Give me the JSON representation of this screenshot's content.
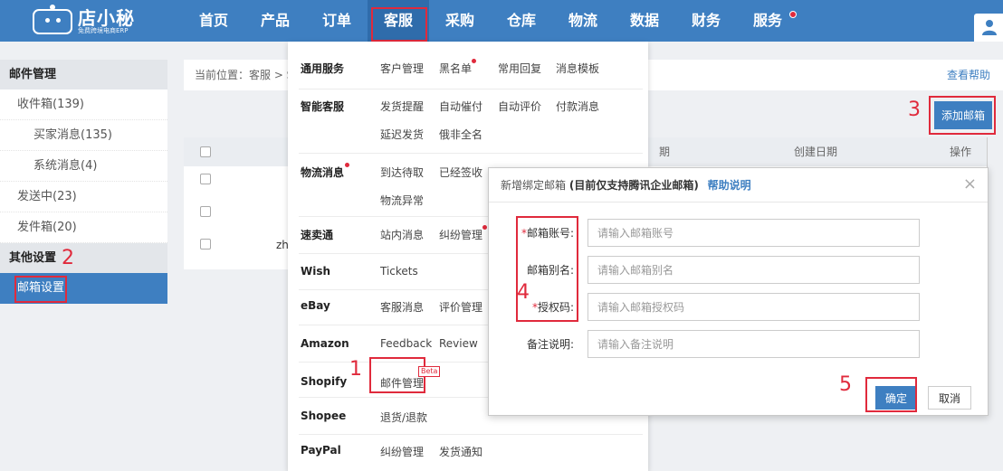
{
  "logo": {
    "main": "店小秘",
    "sub": "免费跨境电商ERP"
  },
  "nav": {
    "items": [
      "首页",
      "产品",
      "订单",
      "客服",
      "采购",
      "仓库",
      "物流",
      "数据",
      "财务",
      "服务"
    ],
    "active_index": 3
  },
  "sidebar": {
    "mail_header": "邮件管理",
    "inbox": "收件箱(139)",
    "buyer_msg": "买家消息(135)",
    "system_msg": "系统消息(4)",
    "sending": "发送中(23)",
    "outbox": "发件箱(20)",
    "other_header": "其他设置",
    "mailbox_settings": "邮箱设置"
  },
  "breadcrumb": {
    "text": "当前位置：客服 > S",
    "help": "查看帮助"
  },
  "toolbar": {
    "add_mailbox": "添加邮箱"
  },
  "table": {
    "col_period": "期",
    "col_created": "创建日期",
    "col_actions": "操作",
    "row3_text": "zh"
  },
  "dropdown": {
    "groups": [
      {
        "label": "通用服务",
        "links": [
          "客户管理",
          "黑名单",
          "常用回复",
          "消息模板"
        ]
      },
      {
        "label": "智能客服",
        "links": [
          "发货提醒",
          "自动催付",
          "自动评价",
          "付款消息",
          "延迟发货",
          "俄非全名"
        ]
      },
      {
        "label": "物流消息",
        "links": [
          "到达待取",
          "已经签收",
          "物流异常"
        ]
      },
      {
        "label": "速卖通",
        "links": [
          "站内消息",
          "纠纷管理"
        ]
      },
      {
        "label": "Wish",
        "links": [
          "Tickets"
        ]
      },
      {
        "label": "eBay",
        "links": [
          "客服消息",
          "评价管理"
        ]
      },
      {
        "label": "Amazon",
        "links": [
          "Feedback",
          "Review"
        ]
      },
      {
        "label": "Shopify",
        "links": [
          "邮件管理"
        ]
      },
      {
        "label": "Shopee",
        "links": [
          "退货/退款"
        ]
      },
      {
        "label": "PayPal",
        "links": [
          "纠纷管理",
          "发货通知"
        ]
      }
    ],
    "beta": "Beta"
  },
  "modal": {
    "title": "新增绑定邮箱",
    "note": "(目前仅支持腾讯企业邮箱)",
    "help": "帮助说明",
    "close": "×",
    "fields": [
      {
        "label": "邮箱账号:",
        "placeholder": "请输入邮箱账号",
        "required": true
      },
      {
        "label": "邮箱别名:",
        "placeholder": "请输入邮箱别名",
        "required": false
      },
      {
        "label": "授权码:",
        "placeholder": "请输入邮箱授权码",
        "required": true
      },
      {
        "label": "备注说明:",
        "placeholder": "请输入备注说明",
        "required": false
      }
    ],
    "confirm": "确定",
    "cancel": "取消"
  },
  "steps": [
    "1",
    "2",
    "3",
    "4",
    "5"
  ],
  "colors": {
    "primary": "#3e7fc1",
    "annotation": "#e02a3c"
  }
}
